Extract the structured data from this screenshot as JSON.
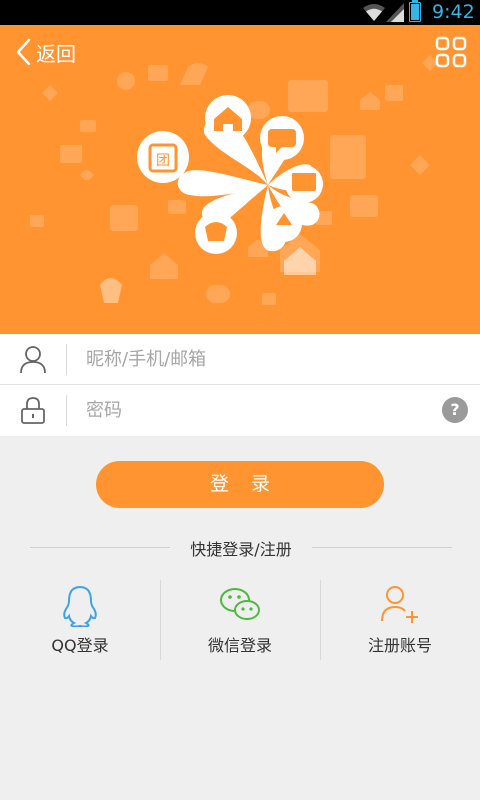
{
  "status_bar": {
    "time": "9:42",
    "icons": [
      "wifi-icon",
      "signal-icon",
      "battery-icon"
    ]
  },
  "header": {
    "back_label": "返回",
    "grid_icon": "grid-icon"
  },
  "form": {
    "username_placeholder": "昵称/手机/邮箱",
    "password_placeholder": "密码",
    "help_label": "?"
  },
  "login_button_label": "登 录",
  "quick_login": {
    "title": "快捷登录/注册",
    "items": [
      {
        "label": "QQ登录",
        "icon": "qq-icon"
      },
      {
        "label": "微信登录",
        "icon": "wechat-icon"
      },
      {
        "label": "注册账号",
        "icon": "add-user-icon"
      }
    ]
  },
  "hero": {
    "badge_text": "团"
  },
  "colors": {
    "accent": "#ff9430",
    "status_blue": "#33b5e5",
    "wechat_green": "#4cba3c",
    "qq_blue": "#3fa2e8"
  }
}
